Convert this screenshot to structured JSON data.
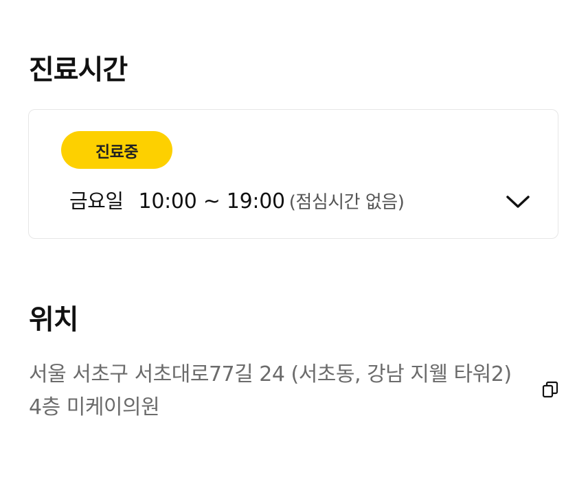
{
  "hours": {
    "title": "진료시간",
    "status_badge": "진료중",
    "day": "금요일",
    "time_range": "10:00 ~ 19:00",
    "lunch_note": "(점심시간 없음)",
    "expand_icon": "chevron-down-icon",
    "badge_color": "#FDD000"
  },
  "location": {
    "title": "위치",
    "address": "서울 서초구 서초대로77길 24 (서초동, 강남 지웰 타워2) 4층 미케이의원",
    "copy_icon": "copy-icon"
  }
}
